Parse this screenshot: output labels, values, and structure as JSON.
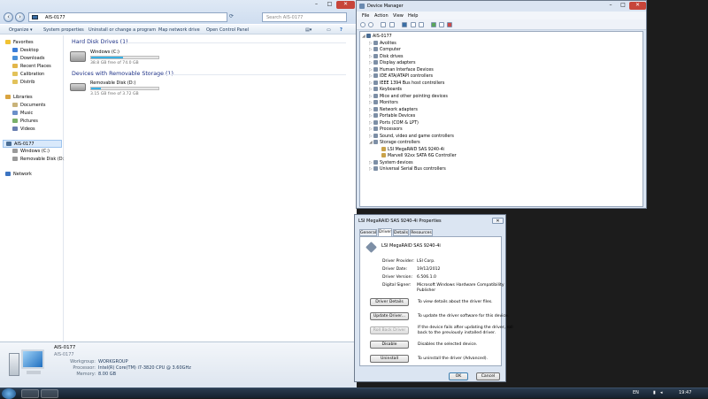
{
  "explorer": {
    "address": "AIS-0177",
    "search_placeholder": "Search AIS-0177",
    "toolbar": [
      "Organize ▾",
      "System properties",
      "Uninstall or change a program",
      "Map network drive",
      "Open Control Panel"
    ],
    "nav": {
      "favorites": {
        "label": "Favorites",
        "items": [
          "Desktop",
          "Downloads",
          "Recent Places",
          "Calibration",
          "Distrib"
        ]
      },
      "libraries": {
        "label": "Libraries",
        "items": [
          "Documents",
          "Music",
          "Pictures",
          "Videos"
        ]
      },
      "computer": {
        "label": "AIS-0177",
        "items": [
          "Windows (C:)",
          "Removable Disk (D:)"
        ]
      },
      "network": "Network"
    },
    "groups": {
      "hdd": "Hard Disk Drives (1)",
      "removable": "Devices with Removable Storage (1)"
    },
    "drives": [
      {
        "name": "Windows (C:)",
        "free": "38.8 GB free of 74.0 GB",
        "used_fraction": 0.48
      },
      {
        "name": "Removable Disk (D:)",
        "free": "3.15 GB free of 3.72 GB",
        "used_fraction": 0.15
      }
    ],
    "details": {
      "name": "AIS-0177",
      "subname": "AIS-0177",
      "workgroup_label": "Workgroup:",
      "workgroup": "WORKGROUP",
      "processor_label": "Processor:",
      "processor": "Intel(R) Core(TM) i7-3820 CPU @ 3.60GHz",
      "memory_label": "Memory:",
      "memory": "8.00 GB"
    }
  },
  "devmgr": {
    "title": "Device Manager",
    "menu": [
      "File",
      "Action",
      "View",
      "Help"
    ],
    "root": "AIS-0177",
    "tree": [
      "Avolites",
      "Computer",
      "Disk drives",
      "Display adapters",
      "Human Interface Devices",
      "IDE ATA/ATAPI controllers",
      "IEEE 1394 Bus host controllers",
      "Keyboards",
      "Mice and other pointing devices",
      "Monitors",
      "Network adapters",
      "Portable Devices",
      "Ports (COM & LPT)",
      "Processors",
      "Sound, video and game controllers",
      "Storage controllers",
      "System devices",
      "Universal Serial Bus controllers"
    ],
    "storage_children": [
      "LSI MegaRAID SAS 9240-4i",
      "Marvell 92xx SATA 6G Controller"
    ]
  },
  "props": {
    "title": "LSI MegaRAID SAS 9240-4i Properties",
    "tabs": [
      "General",
      "Driver",
      "Details",
      "Resources"
    ],
    "device_name": "LSI MegaRAID SAS 9240-4i",
    "fields": [
      {
        "label": "Driver Provider:",
        "value": "LSI Corp."
      },
      {
        "label": "Driver Date:",
        "value": "19/12/2012"
      },
      {
        "label": "Driver Version:",
        "value": "6.506.1.0"
      },
      {
        "label": "Digital Signer:",
        "value": "Microsoft Windows Hardware Compatibility"
      },
      {
        "label": "",
        "value": "Publisher"
      }
    ],
    "buttons": [
      {
        "label": "Driver Details",
        "desc": "To view details about the driver files.",
        "desc2": ""
      },
      {
        "label": "Update Driver...",
        "desc": "To update the driver software for this device.",
        "desc2": ""
      },
      {
        "label": "Roll Back Driver",
        "desc": "If the device fails after updating the driver, roll",
        "desc2": "back to the previously installed driver."
      },
      {
        "label": "Disable",
        "desc": "Disables the selected device.",
        "desc2": ""
      },
      {
        "label": "Uninstall",
        "desc": "To uninstall the driver (Advanced).",
        "desc2": ""
      }
    ],
    "ok": "OK",
    "cancel": "Cancel"
  },
  "taskbar": {
    "lang": "EN",
    "time": "19:47"
  }
}
